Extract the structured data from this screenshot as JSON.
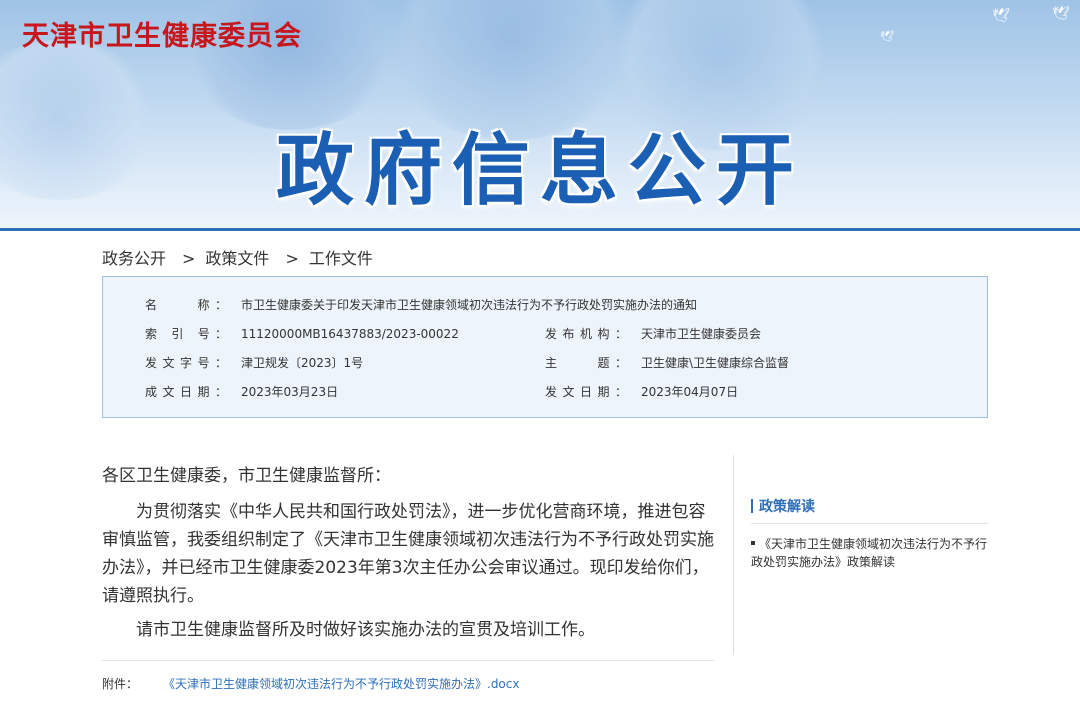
{
  "header": {
    "agency": "天津市卫生健康委员会",
    "banner_title": "政府信息公开"
  },
  "breadcrumb": [
    "政务公开",
    "政策文件",
    "工作文件"
  ],
  "breadcrumb_sep": ">",
  "meta": {
    "name_label": "名　　称：",
    "name_value": "市卫生健康委关于印发天津市卫生健康领域初次违法行为不予行政处罚实施办法的通知",
    "index_label": "索 引 号：",
    "index_value": "11120000MB16437883/2023-00022",
    "org_label": "发布机构：",
    "org_value": "天津市卫生健康委员会",
    "doc_no_label": "发文字号：",
    "doc_no_value": "津卫规发〔2023〕1号",
    "topic_label": "主　　题：",
    "topic_value": "卫生健康\\卫生健康综合监督",
    "written_label": "成文日期：",
    "written_value": "2023年03月23日",
    "issued_label": "发文日期：",
    "issued_value": "2023年04月07日"
  },
  "content": {
    "greeting": "各区卫生健康委，市卫生健康监督所：",
    "para1": "为贯彻落实《中华人民共和国行政处罚法》，进一步优化营商环境，推进包容审慎监管，我委组织制定了《天津市卫生健康领域初次违法行为不予行政处罚实施办法》，并已经市卫生健康委2023年第3次主任办公会审议通过。现印发给你们，请遵照执行。",
    "para2": "请市卫生健康监督所及时做好该实施办法的宣贯及培训工作。"
  },
  "sidebar": {
    "title": "政策解读",
    "link": "《天津市卫生健康领域初次违法行为不予行政处罚实施办法》政策解读"
  },
  "attachment": {
    "label": "附件：",
    "file": "《天津市卫生健康领域初次违法行为不予行政处罚实施办法》.docx"
  },
  "colors": {
    "agency_red": "#c8161d",
    "accent_blue": "#2f6fb8",
    "title_blue": "#1a5fb4",
    "meta_bg": "#eef4fb"
  }
}
